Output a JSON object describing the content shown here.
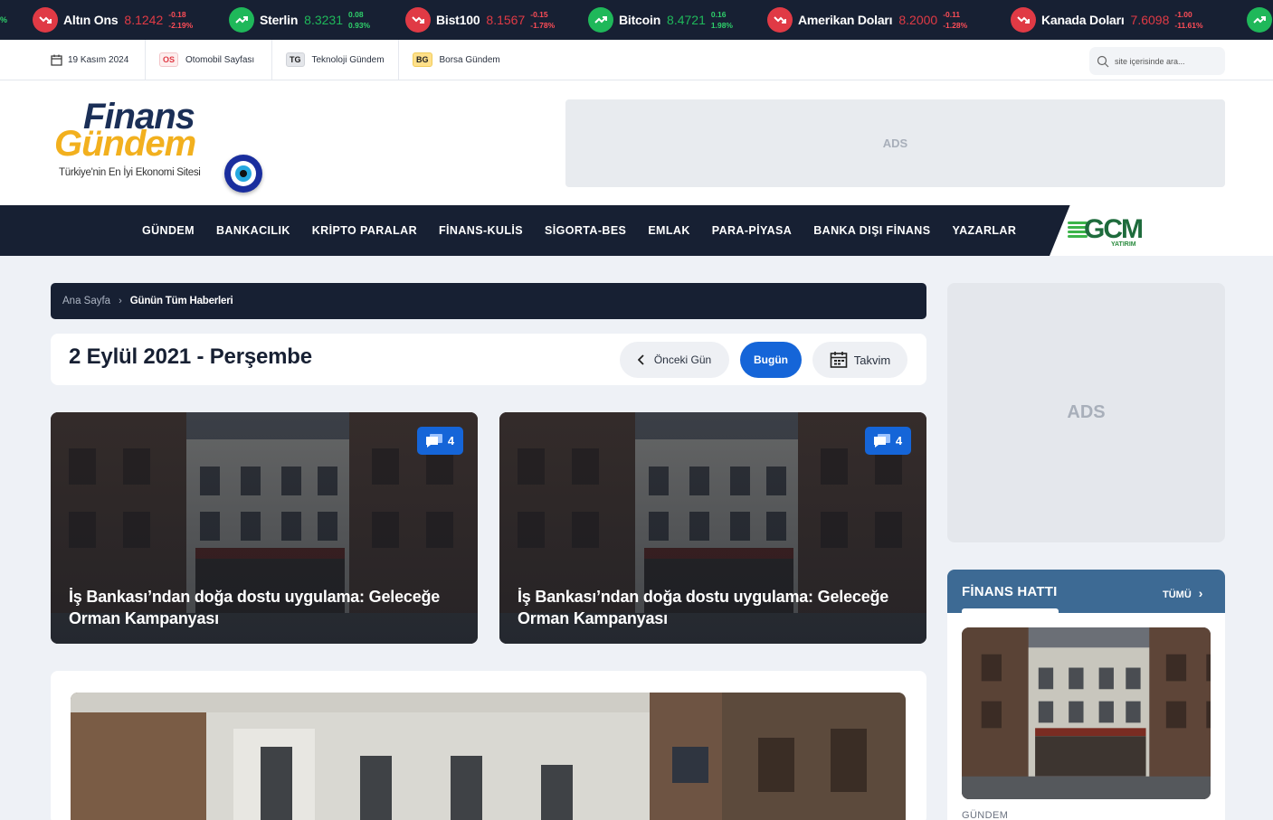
{
  "ticker": [
    {
      "name": "Altın Ons",
      "price": "8.1242",
      "change": "-0.18",
      "percent": "-2.19%",
      "trend": "down",
      "icon": "trend-down-icon"
    },
    {
      "name": "Sterlin",
      "price": "8.3231",
      "change": "0.08",
      "percent": "0.93%",
      "trend": "up",
      "icon": "trend-up-icon"
    },
    {
      "name": "Bist100",
      "price": "8.1567",
      "change": "-0.15",
      "percent": "-1.78%",
      "trend": "down",
      "icon": "trend-down-icon"
    },
    {
      "name": "Bitcoin",
      "price": "8.4721",
      "change": "0.16",
      "percent": "1.98%",
      "trend": "up",
      "icon": "trend-up-icon"
    },
    {
      "name": "Amerikan Doları",
      "price": "8.2000",
      "change": "-0.11",
      "percent": "-1.28%",
      "trend": "down",
      "icon": "trend-down-icon"
    },
    {
      "name": "Kanada Doları",
      "price": "7.6098",
      "change": "-1.00",
      "percent": "-11.61%",
      "trend": "down",
      "icon": "trend-down-icon"
    }
  ],
  "ticker_edge_left": "%",
  "topbar": {
    "date": "19 Kasım 2024",
    "links": [
      {
        "badge": "OS",
        "label": "Otomobil Sayfası"
      },
      {
        "badge": "TG",
        "label": "Teknoloji Gündem"
      },
      {
        "badge": "BG",
        "label": "Borsa Gündem"
      }
    ],
    "search_placeholder": "site içerisinde ara..."
  },
  "logo": {
    "line1": "Finans",
    "line2": "Gündem",
    "tagline": "Türkiye'nin En İyi Ekonomi Sitesi"
  },
  "ads_label": "ADS",
  "nav": [
    "GÜNDEM",
    "BANKACILIK",
    "KRİPTO PARALAR",
    "FİNANS-KULİS",
    "SİGORTA-BES",
    "EMLAK",
    "PARA-PİYASA",
    "BANKA DIŞI FİNANS",
    "YAZARLAR"
  ],
  "partner": {
    "name": "GCM",
    "sub": "YATIRIM"
  },
  "breadcrumb": {
    "home": "Ana Sayfa",
    "current": "Günün Tüm Haberleri"
  },
  "datebar": {
    "title": "2 Eylül 2021 - Perşembe",
    "prev": "Önceki Gün",
    "today": "Bugün",
    "calendar": "Takvim"
  },
  "cards": [
    {
      "title": "İş Bankası’ndan doğa dostu uygulama: Geleceğe Orman Kampanyası",
      "comments": "4"
    },
    {
      "title": "İş Bankası’ndan doğa dostu uygulama: Geleceğe Orman Kampanyası",
      "comments": "4"
    }
  ],
  "widget": {
    "title": "FİNANS HATTI",
    "all": "TÜMÜ",
    "category": "GÜNDEM"
  },
  "colors": {
    "navy": "#172033",
    "accent": "#1565d8",
    "up": "#1fb85a",
    "down": "#e03a45",
    "widget_header": "#3d6a94"
  }
}
